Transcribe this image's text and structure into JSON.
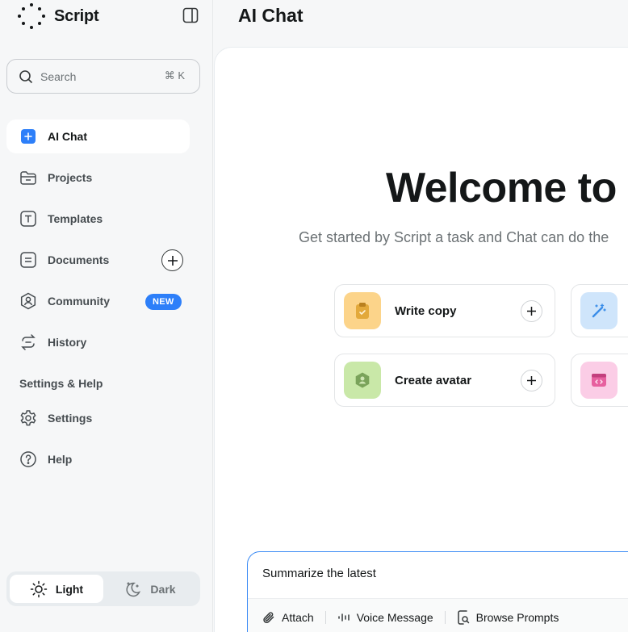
{
  "app": {
    "name": "Script"
  },
  "search": {
    "placeholder": "Search",
    "shortcut": "⌘ K"
  },
  "nav": [
    {
      "label": "AI Chat",
      "icon": "ai-chat-icon",
      "active": true
    },
    {
      "label": "Projects",
      "icon": "folder-icon"
    },
    {
      "label": "Templates",
      "icon": "template-icon"
    },
    {
      "label": "Documents",
      "icon": "document-icon"
    },
    {
      "label": "Community",
      "icon": "community-icon",
      "badge": "NEW"
    },
    {
      "label": "History",
      "icon": "history-icon"
    }
  ],
  "settings_section": {
    "label": "Settings & Help",
    "items": [
      {
        "label": "Settings",
        "icon": "gear-icon"
      },
      {
        "label": "Help",
        "icon": "help-icon"
      }
    ]
  },
  "theme": {
    "light": "Light",
    "dark": "Dark",
    "selected": "Light"
  },
  "main": {
    "title": "AI Chat",
    "welcome": "Welcome to S",
    "subtitle": "Get started by Script a task and Chat can do the",
    "cards": [
      {
        "label": "Write copy",
        "icon": "clipboard-icon",
        "color": "#fcd48a"
      },
      {
        "label": "",
        "icon": "magic-wand-icon",
        "color": "#cfe5fb"
      },
      {
        "label": "Create avatar",
        "icon": "avatar-icon",
        "color": "#c9e8a8"
      },
      {
        "label": "",
        "icon": "code-window-icon",
        "color": "#fbcde6"
      }
    ]
  },
  "composer": {
    "value": "Summarize the latest",
    "tools": [
      {
        "label": "Attach",
        "icon": "paperclip-icon"
      },
      {
        "label": "Voice Message",
        "icon": "waveform-icon"
      },
      {
        "label": "Browse Prompts",
        "icon": "browse-prompts-icon"
      }
    ]
  },
  "colors": {
    "accent": "#2d7ff9",
    "composer_border": "#3d8cf5"
  }
}
